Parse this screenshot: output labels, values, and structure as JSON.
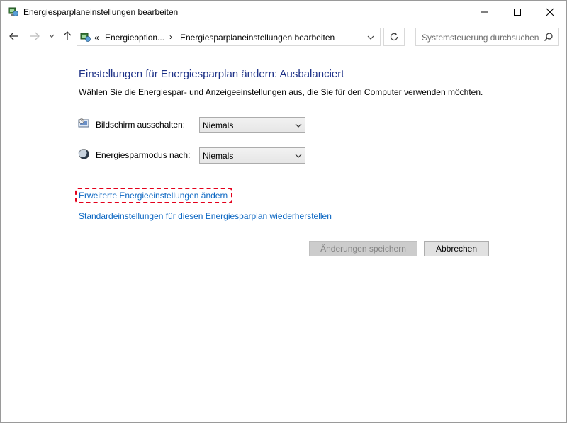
{
  "window": {
    "title": "Energiesparplaneinstellungen bearbeiten"
  },
  "address": {
    "overflow": "«",
    "crumbs": [
      "Energieoption...",
      "Energiesparplaneinstellungen bearbeiten"
    ],
    "separator": "›"
  },
  "search": {
    "placeholder": "Systemsteuerung durchsuchen"
  },
  "main": {
    "heading": "Einstellungen für Energiesparplan ändern: Ausbalanciert",
    "subtext": "Wählen Sie die Energiespar- und Anzeigeeinstellungen aus, die Sie für den Computer verwenden möchten.",
    "display_off": {
      "label": "Bildschirm ausschalten:",
      "value": "Niemals"
    },
    "sleep": {
      "label": "Energiesparmodus nach:",
      "value": "Niemals"
    },
    "link_advanced": "Erweiterte Energieeinstellungen ändern",
    "link_restore": "Standardeinstellungen für diesen Energiesparplan wiederherstellen"
  },
  "buttons": {
    "save": "Änderungen speichern",
    "cancel": "Abbrechen"
  },
  "colors": {
    "heading": "#1e3287",
    "link": "#0a66c2",
    "highlight": "#e3001b"
  }
}
